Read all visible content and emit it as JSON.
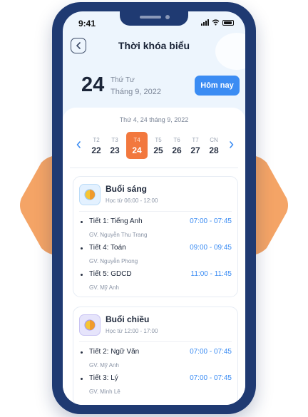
{
  "status_bar": {
    "time": "9:41"
  },
  "header": {
    "title": "Thời khóa biểu"
  },
  "date_summary": {
    "day": "24",
    "weekday": "Thứ Tư",
    "month": "Tháng 9, 2022",
    "today_button": "Hôm nay"
  },
  "week": {
    "caption": "Thứ 4, 24 tháng 9, 2022",
    "days": [
      {
        "name": "T2",
        "date": "22"
      },
      {
        "name": "T3",
        "date": "23"
      },
      {
        "name": "T4",
        "date": "24",
        "active": true
      },
      {
        "name": "T5",
        "date": "25"
      },
      {
        "name": "T6",
        "date": "26"
      },
      {
        "name": "T7",
        "date": "27"
      },
      {
        "name": "CN",
        "date": "28"
      }
    ]
  },
  "sessions": [
    {
      "title": "Buổi sáng",
      "subtitle": "Học từ 06:00 - 12:00",
      "lessons": [
        {
          "name": "Tiết 1: Tiếng Anh",
          "time": "07:00 - 07:45",
          "teacher": "GV. Nguyễn Thu Trang"
        },
        {
          "name": "Tiết 4: Toán",
          "time": "09:00 - 09:45",
          "teacher": "GV. Nguyễn Phong"
        },
        {
          "name": "Tiết 5: GDCD",
          "time": "11:00 - 11:45",
          "teacher": "GV. Mỹ Anh"
        }
      ]
    },
    {
      "title": "Buổi chiều",
      "subtitle": "Học từ 12:00 - 17:00",
      "lessons": [
        {
          "name": "Tiết 2: Ngữ Văn",
          "time": "07:00 - 07:45",
          "teacher": "GV. Mỹ Anh"
        },
        {
          "name": "Tiết 3: Lý",
          "time": "07:00 - 07:45",
          "teacher": "GV. Minh Lê"
        }
      ]
    }
  ],
  "colors": {
    "accent": "#3b8cf3",
    "active_day": "#f2783e",
    "phone_frame": "#1f3a72",
    "background_shape": "#f4a466"
  }
}
